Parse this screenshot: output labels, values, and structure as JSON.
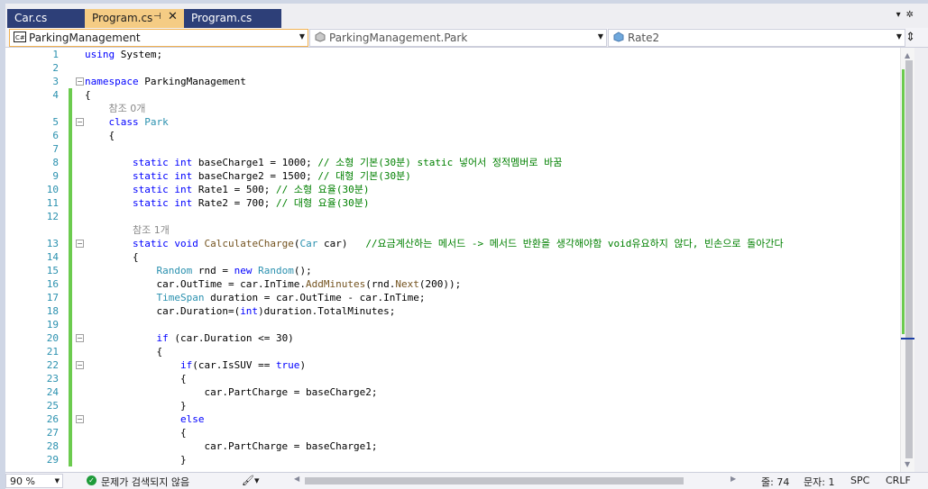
{
  "tabs": [
    {
      "label": "Car.cs",
      "active": false
    },
    {
      "label": "Program.cs",
      "active": true
    },
    {
      "label": "Program.cs",
      "active": false
    }
  ],
  "navbar": {
    "project": "ParkingManagement",
    "type": "ParkingManagement.Park",
    "member": "Rate2"
  },
  "editor": {
    "lines": [
      {
        "n": "1",
        "html": "<span class=\"kw\">using</span> System;"
      },
      {
        "n": "2",
        "html": ""
      },
      {
        "n": "3",
        "html": "<span class=\"kw\">namespace</span> ParkingManagement"
      },
      {
        "n": "4",
        "html": "{"
      },
      {
        "n": "",
        "html": "    <span class=\"ref\">참조 0개</span>"
      },
      {
        "n": "5",
        "html": "    <span class=\"kw\">class</span> <span class=\"ty\">Park</span>"
      },
      {
        "n": "6",
        "html": "    {"
      },
      {
        "n": "7",
        "html": ""
      },
      {
        "n": "8",
        "html": "        <span class=\"kw\">static</span> <span class=\"kw\">int</span> baseCharge1 = 1000; <span class=\"cm\">// 소형 기본(30분) static 넣어서 정적멤버로 바꿈</span>"
      },
      {
        "n": "9",
        "html": "        <span class=\"kw\">static</span> <span class=\"kw\">int</span> baseCharge2 = 1500; <span class=\"cm\">// 대형 기본(30분)</span>"
      },
      {
        "n": "10",
        "html": "        <span class=\"kw\">static</span> <span class=\"kw\">int</span> Rate1 = 500; <span class=\"cm\">// 소형 요율(30분)</span>"
      },
      {
        "n": "11",
        "html": "        <span class=\"kw\">static</span> <span class=\"kw\">int</span> Rate2 = 700; <span class=\"cm\">// 대형 요율(30분)</span>"
      },
      {
        "n": "12",
        "html": ""
      },
      {
        "n": "",
        "html": "        <span class=\"ref\">참조 1개</span>"
      },
      {
        "n": "13",
        "html": "        <span class=\"kw\">static</span> <span class=\"kw\">void</span> <span class=\"mt\">CalculateCharge</span>(<span class=\"ty\">Car</span> car)   <span class=\"cm\">//요금계산하는 메서드 -&gt; 메서드 반환을 생각해야함 void유요하지 않다, 빈손으로 돌아간다</span>"
      },
      {
        "n": "14",
        "html": "        {"
      },
      {
        "n": "15",
        "html": "            <span class=\"ty\">Random</span> rnd = <span class=\"kw\">new</span> <span class=\"ty\">Random</span>();"
      },
      {
        "n": "16",
        "html": "            car.OutTime = car.InTime.<span class=\"mt\">AddMinutes</span>(rnd.<span class=\"mt\">Next</span>(200));"
      },
      {
        "n": "17",
        "html": "            <span class=\"ty\">TimeSpan</span> duration = car.OutTime - car.InTime;"
      },
      {
        "n": "18",
        "html": "            car.Duration=(<span class=\"kw\">int</span>)duration.TotalMinutes;"
      },
      {
        "n": "19",
        "html": ""
      },
      {
        "n": "20",
        "html": "            <span class=\"kw\">if</span> (car.Duration &lt;= 30)"
      },
      {
        "n": "21",
        "html": "            {"
      },
      {
        "n": "22",
        "html": "                <span class=\"kw\">if</span>(car.IsSUV == <span class=\"kw\">true</span>)"
      },
      {
        "n": "23",
        "html": "                {"
      },
      {
        "n": "24",
        "html": "                    car.PartCharge = baseCharge2;"
      },
      {
        "n": "25",
        "html": "                }"
      },
      {
        "n": "26",
        "html": "                <span class=\"kw\">else</span>"
      },
      {
        "n": "27",
        "html": "                {"
      },
      {
        "n": "28",
        "html": "                    car.PartCharge = baseCharge1;"
      },
      {
        "n": "29",
        "html": "                }"
      }
    ]
  },
  "statusbar": {
    "zoom": "90 %",
    "issues": "문제가 검색되지 않음",
    "line": "줄: 74",
    "column": "문자: 1",
    "encoding": "SPC",
    "eol": "CRLF"
  },
  "colors": {
    "active_tab": "#f5cc84",
    "inactive_tab": "#2d3f78",
    "changed_margin": "#6ccb4f",
    "line_number": "#2b91af",
    "keyword": "#0000ff",
    "type": "#2b91af",
    "comment": "#008000"
  }
}
